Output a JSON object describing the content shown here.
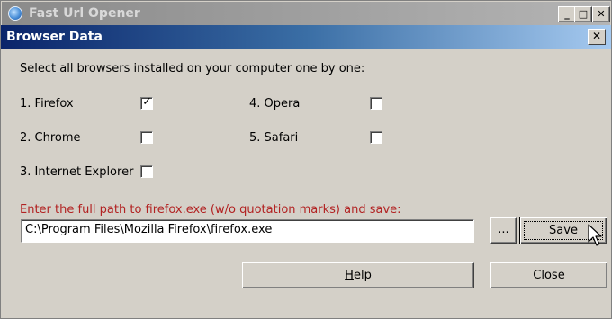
{
  "outer_window": {
    "title": "Fast Url Opener",
    "controls": {
      "minimize": "_",
      "maximize": "□",
      "close": "✕"
    }
  },
  "dialog": {
    "title": "Browser Data",
    "close": "✕",
    "instruction": "Select all browsers installed on your computer one by one:",
    "browsers": [
      {
        "label": "1. Firefox",
        "checked": true
      },
      {
        "label": "2. Chrome",
        "checked": false
      },
      {
        "label": "3. Internet Explorer",
        "checked": false
      },
      {
        "label": "4. Opera",
        "checked": false
      },
      {
        "label": "5. Safari",
        "checked": false
      }
    ],
    "check_mark": "✓",
    "path_prompt": "Enter the full path to firefox.exe (w/o quotation marks) and save:",
    "path_value": "C:\\Program Files\\Mozilla Firefox\\firefox.exe",
    "buttons": {
      "browse": "...",
      "save": "Save",
      "help_prefix": "",
      "help_accel": "H",
      "help_rest": "elp",
      "close": "Close"
    }
  },
  "colors": {
    "prompt": "#b22222",
    "active_title_start": "#0a246a",
    "active_title_end": "#a6caf0"
  },
  "icons": [
    "app-globe-icon",
    "minimize-icon",
    "maximize-icon",
    "close-icon",
    "checkmark-icon",
    "mouse-cursor-icon"
  ]
}
